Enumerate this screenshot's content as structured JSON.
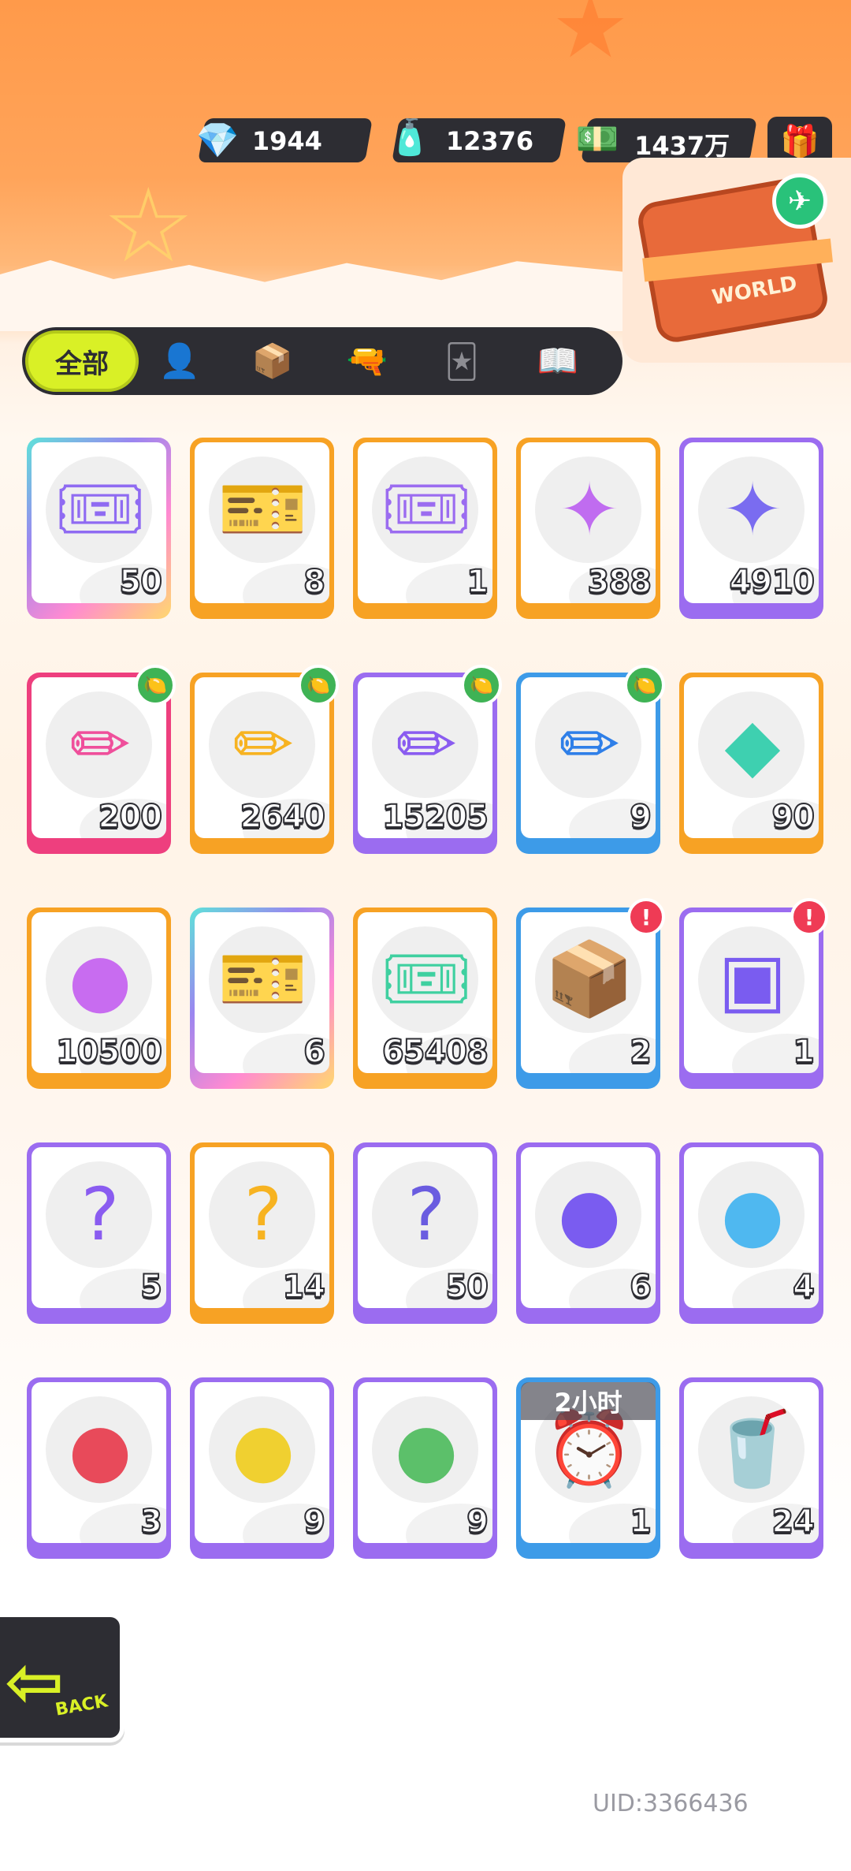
{
  "currencies": [
    {
      "name": "diamond",
      "value": "1944",
      "icon": "diamond-icon",
      "color": "#6aa8ff"
    },
    {
      "name": "spray-can",
      "value": "12376",
      "icon": "spray-can-icon",
      "color": "#3ec8ff"
    },
    {
      "name": "cash",
      "value": "1437万",
      "icon": "cash-icon",
      "color": "#59c84b"
    }
  ],
  "header": {
    "gift_icon": "gift-box-icon",
    "suitcase_label": "WORLD"
  },
  "tabs": [
    {
      "label": "全部",
      "icon": "all-tab",
      "active": true
    },
    {
      "label": "",
      "icon": "person-icon"
    },
    {
      "label": "",
      "icon": "box-icon"
    },
    {
      "label": "",
      "icon": "spray-gun-icon"
    },
    {
      "label": "",
      "icon": "card-icon"
    },
    {
      "label": "",
      "icon": "book-icon"
    }
  ],
  "items": [
    {
      "count": "50",
      "rarity": "rainbow",
      "icon": "ticket-crown-icon",
      "glyph": "🎟",
      "tint": "#8f6bf2"
    },
    {
      "count": "8",
      "rarity": "orange",
      "icon": "ticket-gold-star-icon",
      "glyph": "🎫",
      "tint": "#f7b321"
    },
    {
      "count": "1",
      "rarity": "orange",
      "icon": "ticket-purple-star-icon",
      "glyph": "🎟",
      "tint": "#9b6cf0"
    },
    {
      "count": "388",
      "rarity": "orange",
      "icon": "rainbow-star-icon",
      "glyph": "✦",
      "tint": "#c06cf0"
    },
    {
      "count": "4910",
      "rarity": "purple",
      "icon": "purple-star-icon",
      "glyph": "✦",
      "tint": "#7a6cf0"
    },
    {
      "count": "200",
      "rarity": "pink",
      "icon": "pink-crayon-icon",
      "glyph": "✏",
      "tint": "#ef4f9b",
      "badge": "lemon"
    },
    {
      "count": "2640",
      "rarity": "orange",
      "icon": "yellow-crayon-icon",
      "glyph": "✏",
      "tint": "#f7b321",
      "badge": "lemon"
    },
    {
      "count": "15205",
      "rarity": "purple",
      "icon": "purple-crayon-icon",
      "glyph": "✏",
      "tint": "#8a5cf0",
      "badge": "lemon"
    },
    {
      "count": "9",
      "rarity": "blue",
      "icon": "blue-crayon-icon",
      "glyph": "✏",
      "tint": "#2f7fe8",
      "badge": "lemon"
    },
    {
      "count": "90",
      "rarity": "orange",
      "icon": "color-block-icon",
      "glyph": "◆",
      "tint": "#3ed0b0"
    },
    {
      "count": "10500",
      "rarity": "orange",
      "icon": "cool-coin-icon",
      "glyph": "●",
      "tint": "#c86cf0"
    },
    {
      "count": "6",
      "rarity": "rainbow",
      "icon": "lottery-ticket-icon",
      "glyph": "🎫",
      "tint": "#4fc4e8"
    },
    {
      "count": "65408",
      "rarity": "orange",
      "icon": "season-ticket-icon",
      "glyph": "🎟",
      "tint": "#3fd0a0"
    },
    {
      "count": "2",
      "rarity": "blue",
      "icon": "cool-box-icon",
      "glyph": "📦",
      "tint": "#f7a224",
      "badge": "alert"
    },
    {
      "count": "1",
      "rarity": "purple",
      "icon": "travel-card-icon",
      "glyph": "▣",
      "tint": "#7a5cf0",
      "badge": "alert"
    },
    {
      "count": "5",
      "rarity": "purple",
      "icon": "mystery-egg-icon",
      "glyph": "?",
      "tint": "#8a5cf0"
    },
    {
      "count": "14",
      "rarity": "orange",
      "icon": "mystery-deity-icon",
      "glyph": "?",
      "tint": "#f7b321"
    },
    {
      "count": "50",
      "rarity": "purple",
      "icon": "mystery-travel-card-icon",
      "glyph": "?",
      "tint": "#6a5ce0"
    },
    {
      "count": "6",
      "rarity": "purple",
      "icon": "bat-pet-ball-icon",
      "glyph": "●",
      "tint": "#7a5cf0"
    },
    {
      "count": "4",
      "rarity": "purple",
      "icon": "fish-pet-ball-icon",
      "glyph": "●",
      "tint": "#4fb8f0"
    },
    {
      "count": "3",
      "rarity": "purple",
      "icon": "piranha-pet-ball-icon",
      "glyph": "●",
      "tint": "#e84a5a"
    },
    {
      "count": "9",
      "rarity": "purple",
      "icon": "jellyfish-pet-ball-icon",
      "glyph": "●",
      "tint": "#f0d030"
    },
    {
      "count": "9",
      "rarity": "purple",
      "icon": "plant-pet-ball-icon",
      "glyph": "●",
      "tint": "#5cc06a"
    },
    {
      "count": "1",
      "rarity": "blue",
      "icon": "alarm-clock-icon",
      "glyph": "⏰",
      "tint": "#4fa8f0",
      "timer": "2小时"
    },
    {
      "count": "24",
      "rarity": "purple",
      "icon": "open-drink-cup-icon",
      "glyph": "🥤",
      "tint": "#5cd080"
    }
  ],
  "back_button": {
    "label": "BACK"
  },
  "uid": "UID:3366436"
}
